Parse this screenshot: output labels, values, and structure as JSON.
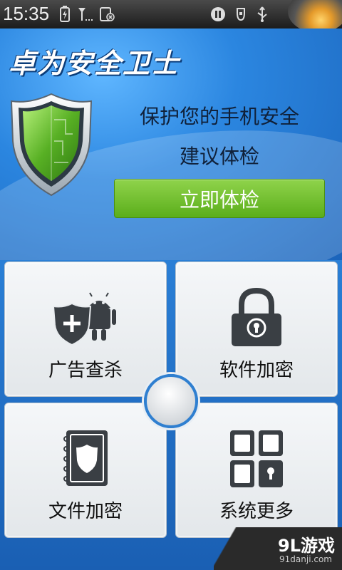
{
  "status_bar": {
    "time": "15:35",
    "left_icons": [
      "battery-charging-icon",
      "signal-icon",
      "sim-icon"
    ],
    "right_icons": [
      "media-icon",
      "usb-debug-icon",
      "usb-icon"
    ]
  },
  "header": {
    "app_title": "卓为安全卫士"
  },
  "hero": {
    "slogan_line1": "保护您的手机安全",
    "slogan_line2": "建议体检",
    "check_button": "立即体检"
  },
  "features": [
    {
      "label": "广告查杀",
      "icon": "android-shield-icon"
    },
    {
      "label": "软件加密",
      "icon": "padlock-icon"
    },
    {
      "label": "文件加密",
      "icon": "document-shield-icon"
    },
    {
      "label": "系统更多",
      "icon": "grid-more-icon"
    }
  ],
  "watermark": {
    "brand": "9L游戏",
    "site": "91danji.com"
  },
  "colors": {
    "accent_green": "#6cbf2a",
    "background_blue": "#1e6fc4"
  }
}
